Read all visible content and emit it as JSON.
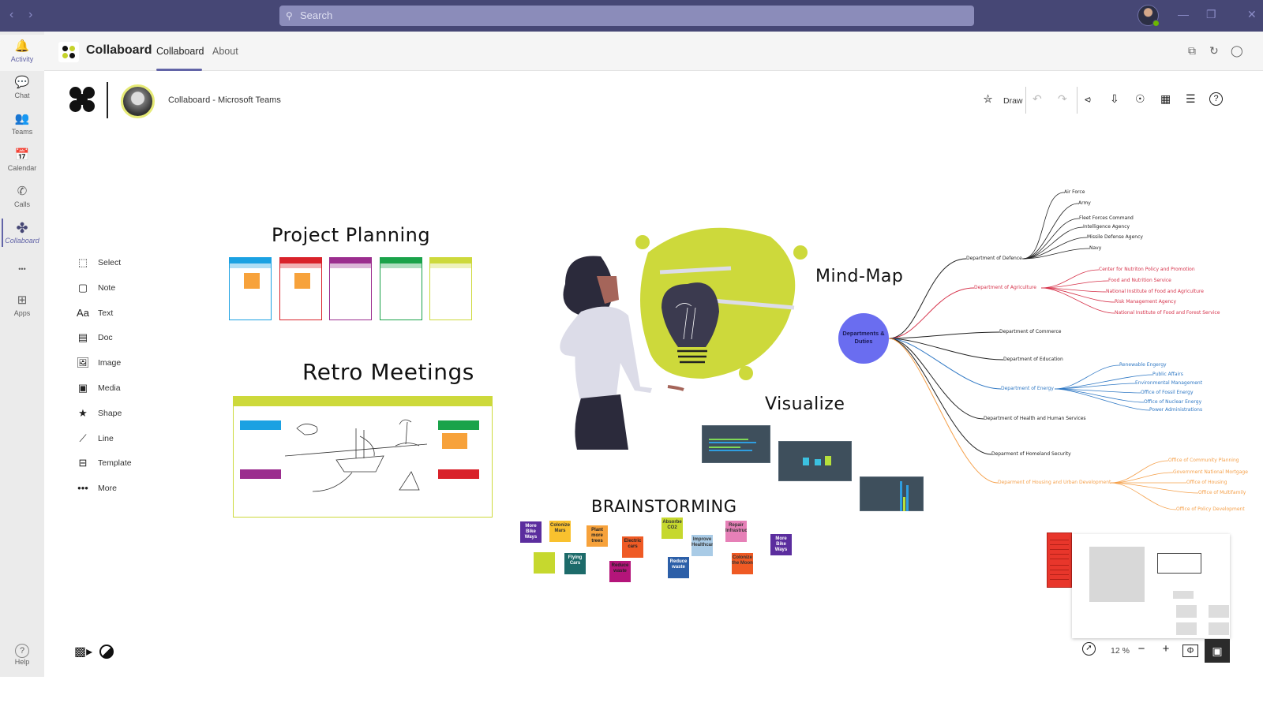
{
  "titlebar": {
    "back_icon": "chevron-left-icon",
    "forward_icon": "chevron-right-icon",
    "search_placeholder": "Search",
    "window_controls": [
      "minimize",
      "maximize",
      "close"
    ]
  },
  "rail": {
    "items": [
      {
        "label": "Activity",
        "icon": "bell-icon",
        "glyph": "🔔"
      },
      {
        "label": "Chat",
        "icon": "chat-icon",
        "glyph": "💬"
      },
      {
        "label": "Teams",
        "icon": "teams-icon",
        "glyph": "👥"
      },
      {
        "label": "Calendar",
        "icon": "calendar-icon",
        "glyph": "📅"
      },
      {
        "label": "Calls",
        "icon": "phone-icon",
        "glyph": "✆"
      },
      {
        "label": "Collaboard",
        "icon": "collaboard-icon",
        "glyph": "✤"
      },
      {
        "label": "",
        "icon": "more-icon",
        "glyph": "•••"
      },
      {
        "label": "Apps",
        "icon": "apps-icon",
        "glyph": "⊞"
      }
    ],
    "help": {
      "label": "Help",
      "icon": "help-icon",
      "glyph": "?"
    }
  },
  "apphead": {
    "app_name": "Collaboard",
    "tabs": [
      "Collaboard",
      "About"
    ],
    "selected_tab": "Collaboard",
    "right_icons": [
      "popout-icon",
      "refresh-icon",
      "shield-icon"
    ]
  },
  "board": {
    "title": "Collaboard - Microsoft Teams",
    "toolbar": {
      "draw_label": "Draw",
      "icons": [
        "draw-icon",
        "undo-icon",
        "redo-icon",
        "share-icon",
        "export-icon",
        "presenter-icon",
        "grid-icon",
        "settings-icon",
        "help-icon"
      ]
    },
    "tools": [
      {
        "label": "Select",
        "icon": "select-icon",
        "glyph": "⬚"
      },
      {
        "label": "Note",
        "icon": "note-icon",
        "glyph": "▢"
      },
      {
        "label": "Text",
        "icon": "text-icon",
        "glyph": "Aa"
      },
      {
        "label": "Doc",
        "icon": "doc-icon",
        "glyph": "▤"
      },
      {
        "label": "Image",
        "icon": "image-icon",
        "glyph": "🖼"
      },
      {
        "label": "Media",
        "icon": "media-icon",
        "glyph": "▣"
      },
      {
        "label": "Shape",
        "icon": "star-icon",
        "glyph": "★"
      },
      {
        "label": "Line",
        "icon": "line-icon",
        "glyph": "⟋"
      },
      {
        "label": "Template",
        "icon": "template-icon",
        "glyph": "⊟"
      },
      {
        "label": "More",
        "icon": "more-icon",
        "glyph": "•••"
      }
    ],
    "sections": {
      "project_planning": "Project Planning",
      "retro_meetings": "Retro Meetings",
      "mind_map": "Mind-Map",
      "visualize": "Visualize",
      "brainstorming": "BRAINSTORMING"
    },
    "kanban_colors": [
      "#1ba1e2",
      "#d9222a",
      "#9b2d8e",
      "#1aa34a",
      "#cdd93b"
    ],
    "sticky_notes": [
      {
        "text": "More Bike Ways",
        "color": "#5b2d9e",
        "fg": "#fff"
      },
      {
        "text": "Colonize Mars",
        "color": "#f9c12e",
        "fg": "#333"
      },
      {
        "text": "Plant more trees",
        "color": "#f7a23b",
        "fg": "#222"
      },
      {
        "text": "Electric cars",
        "color": "#ef5a24",
        "fg": "#222"
      },
      {
        "text": "Absorbe CO2",
        "color": "#c6d82e",
        "fg": "#333"
      },
      {
        "text": "Improve Healthcare",
        "color": "#a9cbe6",
        "fg": "#333"
      },
      {
        "text": "Repair Infrastructure",
        "color": "#e680b7",
        "fg": "#333"
      },
      {
        "text": "More Bike Ways",
        "color": "#5b2d9e",
        "fg": "#fff"
      },
      {
        "text": "",
        "color": "#c6d82e",
        "fg": "#333"
      },
      {
        "text": "Flying Cars",
        "color": "#1d6b6a",
        "fg": "#fff"
      },
      {
        "text": "Reduce waste",
        "color": "#b4157a",
        "fg": "#222"
      },
      {
        "text": "Reduce waste",
        "color": "#2c5fa8",
        "fg": "#fff"
      },
      {
        "text": "Colonize the Moon",
        "color": "#ef5a24",
        "fg": "#333"
      }
    ],
    "mind_map": {
      "center": "Departments & Duties",
      "branches": [
        {
          "label": "Department of Defence",
          "color": "#222222",
          "children": [
            "Air Force",
            "Army",
            "Fleet Forces Command",
            "Intelligence Agency",
            "Missile Defense Agency",
            "Navy"
          ]
        },
        {
          "label": "Department of Agriculture",
          "color": "#d6324a",
          "children": [
            "Center for Nutriton Policy and Promotion",
            "Food and Nutrition Service",
            "National Institute of Food and Agriculture",
            "Risk Management Agency",
            "National Institute of Food and Forest Service"
          ]
        },
        {
          "label": "Department of Commerce",
          "color": "#222222",
          "children": []
        },
        {
          "label": "Department of Education",
          "color": "#222222",
          "children": []
        },
        {
          "label": "Department of Energy",
          "color": "#2f78c4",
          "children": [
            "Renewable Engergy",
            "Public Affairs",
            "Environmental Management",
            "Office of Fossil Energy",
            "Office of Nuclear Energy",
            "Power Administrations"
          ]
        },
        {
          "label": "Department of Health and Human Services",
          "color": "#222222",
          "children": []
        },
        {
          "label": "Deparment of Homeland Security",
          "color": "#222222",
          "children": []
        },
        {
          "label": "Deparment of Housing and Urban Development",
          "color": "#f5a04a",
          "children": [
            "Office of Community Planning",
            "Government National Mortgage",
            "Office of Housing",
            "Office of Multifamily",
            "Office of Policy Development"
          ]
        }
      ]
    },
    "zoom": {
      "value": "12 %",
      "icons": [
        "compass-icon",
        "zoom-out-icon",
        "zoom-in-icon",
        "fit-icon",
        "minimap-icon"
      ]
    },
    "bottom_left_icons": [
      "video-icon",
      "theme-icon"
    ]
  },
  "colors": {
    "titlebar": "#464775",
    "accent": "#6264a7",
    "lime": "#cdd93b",
    "mind_center": "#6a6df0"
  }
}
